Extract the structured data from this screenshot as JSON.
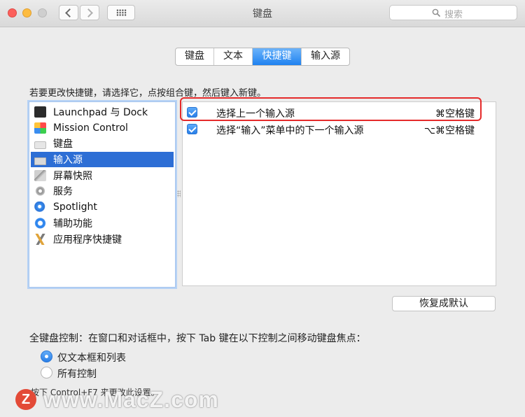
{
  "window": {
    "title": "键盘",
    "search_placeholder": "搜索"
  },
  "tabs": [
    {
      "label": "键盘",
      "active": false
    },
    {
      "label": "文本",
      "active": false
    },
    {
      "label": "快捷键",
      "active": true
    },
    {
      "label": "输入源",
      "active": false
    }
  ],
  "instruction": "若要更改快捷键，请选择它，点按组合键，然后键入新键。",
  "categories": [
    {
      "label": "Launchpad 与 Dock",
      "icon": "launchpad-icon"
    },
    {
      "label": "Mission Control",
      "icon": "mission-control-icon"
    },
    {
      "label": "键盘",
      "icon": "keyboard-icon"
    },
    {
      "label": "输入源",
      "icon": "input-source-icon",
      "selected": true
    },
    {
      "label": "屏幕快照",
      "icon": "screenshot-icon"
    },
    {
      "label": "服务",
      "icon": "services-gear-icon"
    },
    {
      "label": "Spotlight",
      "icon": "spotlight-icon"
    },
    {
      "label": "辅助功能",
      "icon": "accessibility-icon"
    },
    {
      "label": "应用程序快捷键",
      "icon": "app-shortcuts-icon"
    }
  ],
  "shortcuts": [
    {
      "label": "选择上一个输入源",
      "keys": "⌘空格键",
      "checked": true
    },
    {
      "label": "选择“输入”菜单中的下一个输入源",
      "keys": "⌥⌘空格键",
      "checked": true
    }
  ],
  "restore_button": "恢复成默认",
  "full_keyboard": {
    "label": "全键盘控制：在窗口和对话框中，按下 Tab 键在以下控制之间移动键盘焦点：",
    "options": [
      {
        "label": "仅文本框和列表",
        "selected": true
      },
      {
        "label": "所有控制",
        "selected": false
      }
    ],
    "hint": "按下 Control+F7 来更改此设置。"
  },
  "watermark": {
    "logo": "Z",
    "text": "www.MacZ.com"
  },
  "colors": {
    "accent": "#2d6ed5",
    "highlight_box": "#e52a2a"
  }
}
